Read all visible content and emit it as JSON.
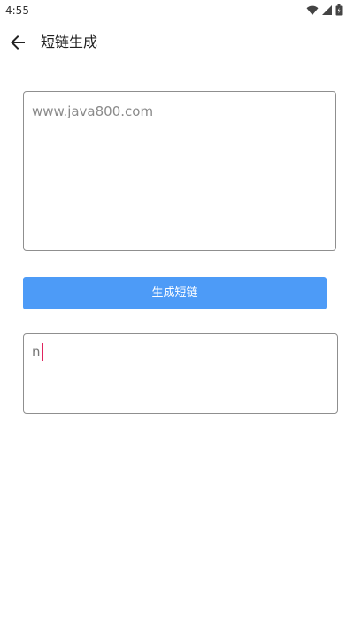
{
  "status_bar": {
    "time": "4:55",
    "icons": [
      "wifi-icon",
      "signal-icon",
      "battery-icon"
    ]
  },
  "app_bar": {
    "back_icon": "arrow-left-icon",
    "title": "短链生成"
  },
  "form": {
    "url_input": {
      "placeholder": "www.java800.com",
      "value": ""
    },
    "generate_button_label": "生成短链",
    "result_output": {
      "value": "n"
    }
  },
  "colors": {
    "accent": "#4d9bf7",
    "caret": "#e0245e",
    "border": "#8f8f8f"
  }
}
